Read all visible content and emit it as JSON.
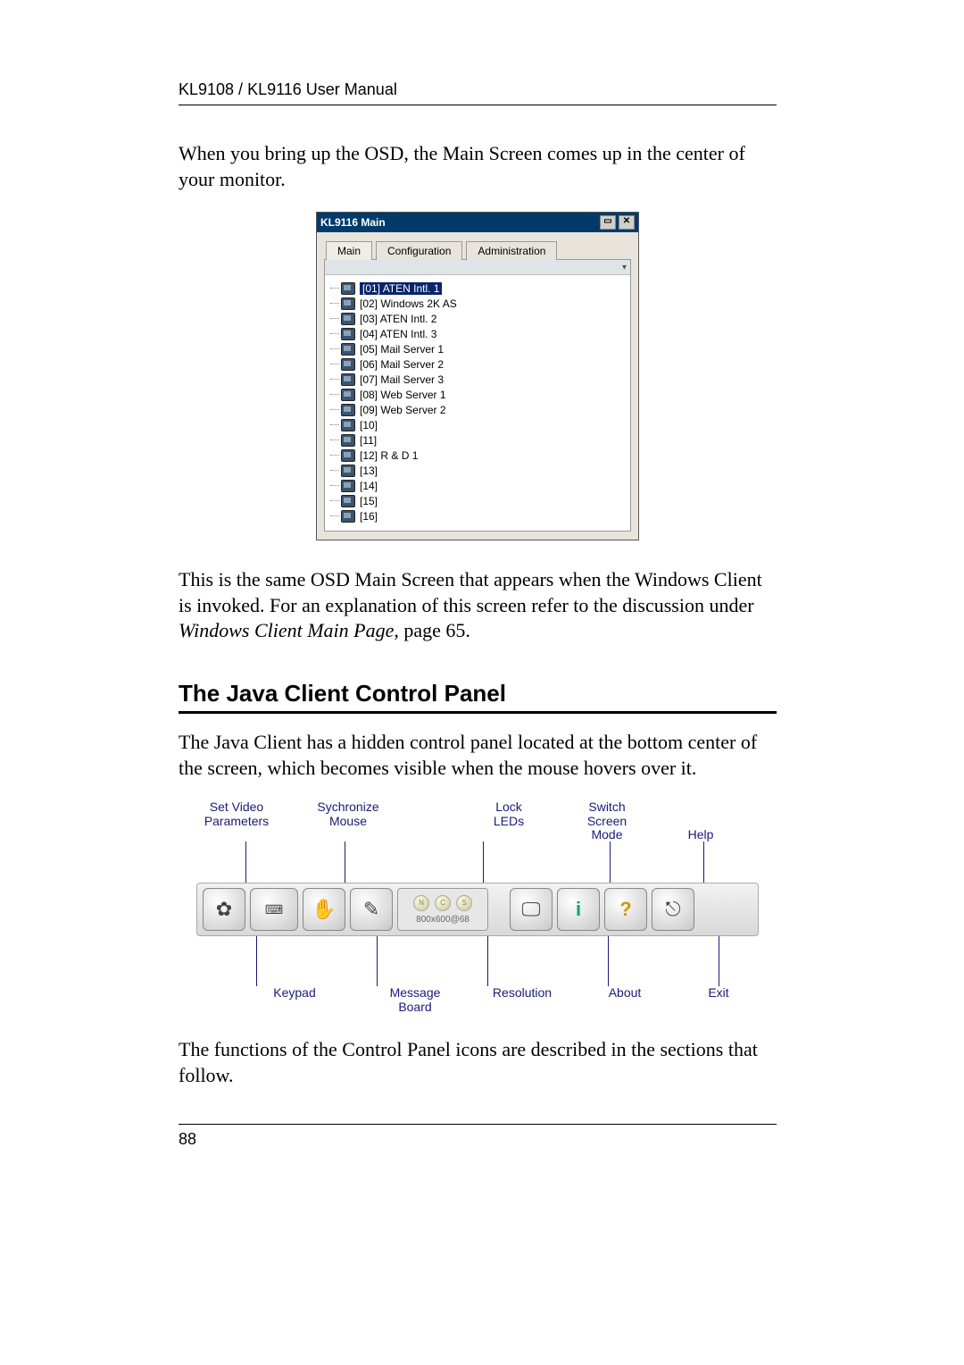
{
  "header": "KL9108 / KL9116  User Manual",
  "page_number": "88",
  "intro_text": "When you bring up the OSD, the Main Screen comes up in the center of your monitor.",
  "osd": {
    "title": "KL9116 Main",
    "tabs": {
      "main": "Main",
      "config": "Configuration",
      "admin": "Administration"
    },
    "items": [
      {
        "label": "[01]  ATEN Intl. 1"
      },
      {
        "label": "[02]  Windows 2K AS"
      },
      {
        "label": "[03]  ATEN Intl. 2"
      },
      {
        "label": "[04]  ATEN Intl. 3"
      },
      {
        "label": "[05]  Mail Server 1"
      },
      {
        "label": "[06]  Mail Server 2"
      },
      {
        "label": "[07]  Mail Server 3"
      },
      {
        "label": "[08]  Web Server 1"
      },
      {
        "label": "[09]  Web Server 2"
      },
      {
        "label": "[10]"
      },
      {
        "label": "[11]"
      },
      {
        "label": "[12]  R & D 1"
      },
      {
        "label": "[13]"
      },
      {
        "label": "[14]"
      },
      {
        "label": "[15]"
      },
      {
        "label": "[16]"
      }
    ]
  },
  "mid_text_a": "This is the same OSD Main Screen that appears when the Windows Client is invoked. For an explanation of this screen refer to the discussion under ",
  "mid_text_b": "Windows Client Main Page",
  "mid_text_c": ", page 65.",
  "section_title": "The Java Client Control Panel",
  "section_text": "The Java Client has a hidden control panel located at the bottom center of the screen, which becomes visible when the mouse hovers over it.",
  "cp": {
    "top": {
      "setvideo": "Set Video\nParameters",
      "sync": "Sychronize\nMouse",
      "lock": "Lock\nLEDs",
      "switch": "Switch\nScreen\nMode",
      "help": "Help"
    },
    "res_text": "800x600@68",
    "leds": {
      "n": "N",
      "c": "C",
      "s": "S"
    },
    "bottom": {
      "keypad": "Keypad",
      "msg": "Message\nBoard",
      "res": "Resolution",
      "about": "About",
      "exit": "Exit"
    }
  },
  "out_text": "The functions of the Control Panel icons are described in the sections that follow."
}
